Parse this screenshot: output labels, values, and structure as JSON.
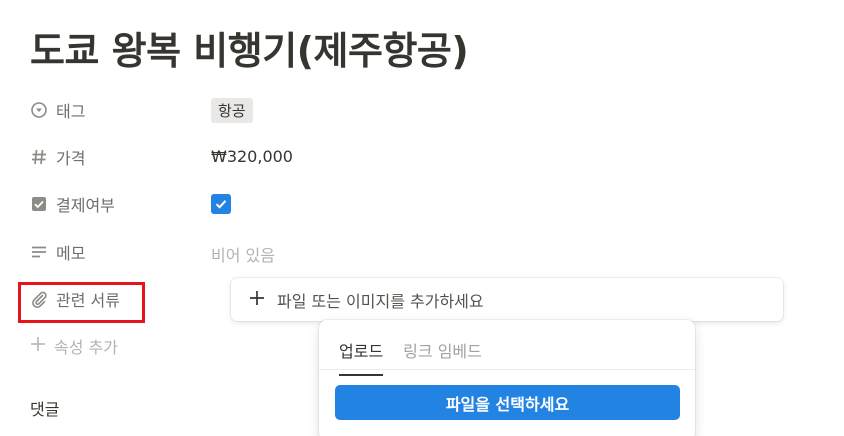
{
  "page": {
    "title": "도쿄 왕복 비행기(제주항공)"
  },
  "properties": [
    {
      "label": "태그",
      "icon": "select-icon",
      "value": "항공"
    },
    {
      "label": "가격",
      "icon": "hash-icon",
      "value": "₩320,000"
    },
    {
      "label": "결제여부",
      "icon": "checkbox-icon",
      "value_checked": true
    },
    {
      "label": "메모",
      "icon": "text-lines-icon",
      "value": "비어 있음"
    },
    {
      "label": "관련 서류",
      "icon": "paperclip-icon"
    }
  ],
  "file_bar": {
    "text": "파일 또는 이미지를 추가하세요"
  },
  "add_property": {
    "label": "속성 추가"
  },
  "comments": {
    "label": "댓글"
  },
  "upload_popup": {
    "tabs": [
      {
        "label": "업로드",
        "active": true
      },
      {
        "label": "링크 임베드",
        "active": false
      }
    ],
    "button_label": "파일을 선택하세요"
  },
  "colors": {
    "accent": "#2383e2",
    "highlight": "#e8141c",
    "text": "#37352f",
    "muted": "#6f6e69",
    "placeholder": "#b4b3ae",
    "tag_bg": "#e9e8e6"
  }
}
